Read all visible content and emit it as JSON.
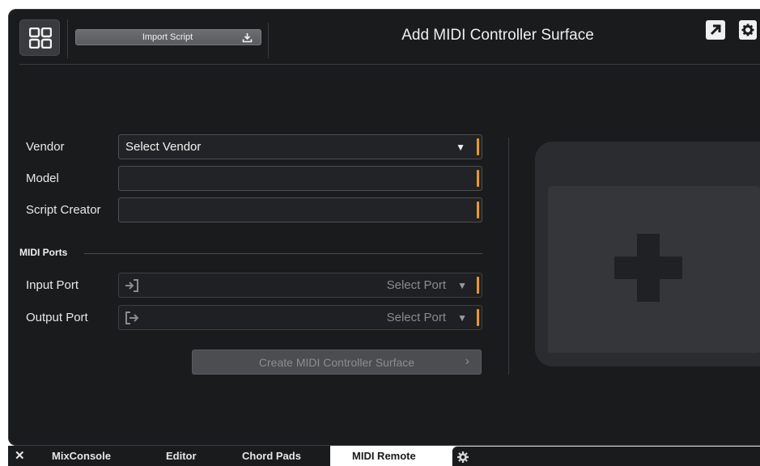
{
  "header": {
    "title": "Add MIDI Controller Surface",
    "import_label": "Import Script",
    "icons": {
      "grid": "grid-icon",
      "import": "download-icon",
      "popout": "arrow-up-right-icon",
      "settings": "gear-icon"
    }
  },
  "form": {
    "vendor_label": "Vendor",
    "vendor_value": "Select Vendor",
    "model_label": "Model",
    "model_value": "",
    "creator_label": "Script Creator",
    "creator_value": ""
  },
  "midi_ports": {
    "section_label": "MIDI Ports",
    "input_label": "Input Port",
    "input_value": "Select Port",
    "output_label": "Output Port",
    "output_value": "Select Port"
  },
  "create_button_label": "Create MIDI Controller Surface",
  "tabs": [
    {
      "label": "MixConsole"
    },
    {
      "label": "Editor"
    },
    {
      "label": "Chord Pads"
    },
    {
      "label": "MIDI Remote",
      "active": true
    }
  ],
  "colors": {
    "accent": "#e89a2a",
    "panel": "#1a1b1d"
  }
}
